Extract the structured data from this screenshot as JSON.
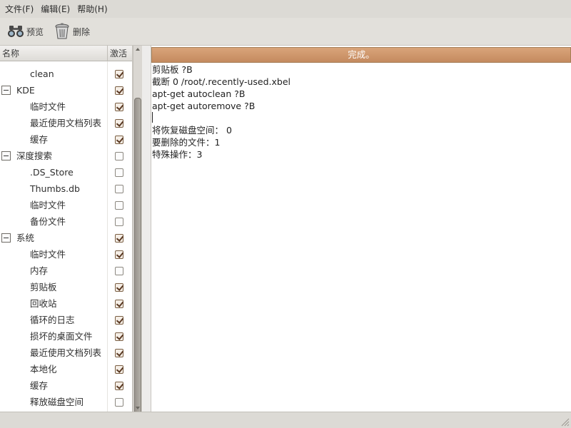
{
  "menubar": {
    "items": [
      "文件(F)",
      "编辑(E)",
      "帮助(H)"
    ]
  },
  "toolbar": {
    "preview_label": "预览",
    "delete_label": "删除"
  },
  "tree": {
    "columns": {
      "name": "名称",
      "active": "激活"
    },
    "rows": [
      {
        "label": "clean",
        "level": 1,
        "checked": true
      },
      {
        "label": "KDE",
        "level": 0,
        "checked": true,
        "expanded": true
      },
      {
        "label": "临时文件",
        "level": 1,
        "checked": true
      },
      {
        "label": "最近使用文档列表",
        "level": 1,
        "checked": true
      },
      {
        "label": "缓存",
        "level": 1,
        "checked": true
      },
      {
        "label": "深度搜索",
        "level": 0,
        "checked": false,
        "expanded": true
      },
      {
        "label": ".DS_Store",
        "level": 1,
        "checked": false
      },
      {
        "label": "Thumbs.db",
        "level": 1,
        "checked": false
      },
      {
        "label": "临时文件",
        "level": 1,
        "checked": false
      },
      {
        "label": "备份文件",
        "level": 1,
        "checked": false
      },
      {
        "label": "系统",
        "level": 0,
        "checked": true,
        "expanded": true
      },
      {
        "label": "临时文件",
        "level": 1,
        "checked": true
      },
      {
        "label": "内存",
        "level": 1,
        "checked": false
      },
      {
        "label": "剪贴板",
        "level": 1,
        "checked": true
      },
      {
        "label": "回收站",
        "level": 1,
        "checked": true
      },
      {
        "label": "循环的日志",
        "level": 1,
        "checked": true
      },
      {
        "label": "损坏的桌面文件",
        "level": 1,
        "checked": true
      },
      {
        "label": "最近使用文档列表",
        "level": 1,
        "checked": true
      },
      {
        "label": "本地化",
        "level": 1,
        "checked": true
      },
      {
        "label": "缓存",
        "level": 1,
        "checked": true
      },
      {
        "label": "释放磁盘空间",
        "level": 1,
        "checked": false
      }
    ]
  },
  "progress": {
    "text": "完成。",
    "fraction": 1.0
  },
  "log": {
    "lines": [
      "剪贴板 ?B",
      "截断 0 /root/.recently-used.xbel",
      "apt-get autoclean ?B",
      "apt-get autoremove ?B",
      "",
      "将恢复磁盘空间： 0",
      "要删除的文件：1",
      "特殊操作：3"
    ]
  },
  "colors": {
    "accent": "#c48a5f",
    "checkmark": "#5a3a24"
  }
}
